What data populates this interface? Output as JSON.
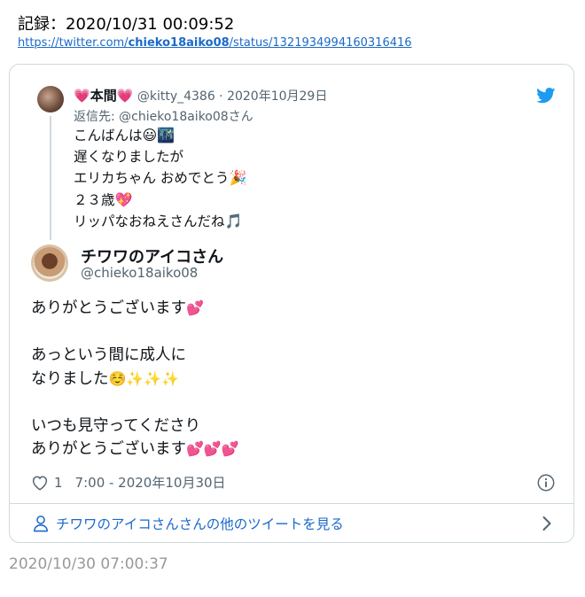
{
  "header": {
    "record_label": "記録：2020/10/31 00:09:52",
    "url_prefix": "https://twitter.com/",
    "url_user": "chieko18aiko08",
    "url_suffix": "/status/1321934994160316416"
  },
  "quoted_tweet": {
    "name": "本間",
    "handle_date": "@kitty_4386 · 2020年10月29日",
    "reply_to": "返信先: @chieko18aiko08さん",
    "lines": [
      {
        "text": "こんばんは",
        "emoji": "😃🌃"
      },
      {
        "text": "遅くなりましたが",
        "emoji": ""
      },
      {
        "text": "エリカちゃん おめでとう",
        "emoji": "🎉"
      },
      {
        "text": "２３歳",
        "emoji": "💖"
      },
      {
        "text": "リッパなおねえさんだね",
        "emoji": "🎵"
      }
    ]
  },
  "main_tweet": {
    "name": "チワワのアイコさん",
    "handle": "@chieko18aiko08",
    "lines": [
      {
        "text": "ありがとうございます",
        "emoji": "💕"
      },
      {
        "text": "",
        "emoji": ""
      },
      {
        "text": "あっという間に成人に",
        "emoji": ""
      },
      {
        "text": "なりました",
        "emoji": "☺️✨✨✨"
      },
      {
        "text": "",
        "emoji": ""
      },
      {
        "text": "いつも見守ってくださり",
        "emoji": ""
      },
      {
        "text": "ありがとうございます",
        "emoji": "💕💕💕"
      }
    ],
    "like_count": "1",
    "timestamp": "7:00 - 2020年10月30日"
  },
  "more_tweets_label": "チワワのアイコさんさんの他のツイートを見る",
  "footer_time": "2020/10/30 07:00:37",
  "colors": {
    "link": "#1b6ac9",
    "twitter_blue": "#1d9bf0",
    "heart": "#e0245e"
  },
  "icons": [
    "heart-outline-icon",
    "info-icon",
    "person-icon",
    "chevron-right-icon",
    "twitter-bird-icon"
  ]
}
